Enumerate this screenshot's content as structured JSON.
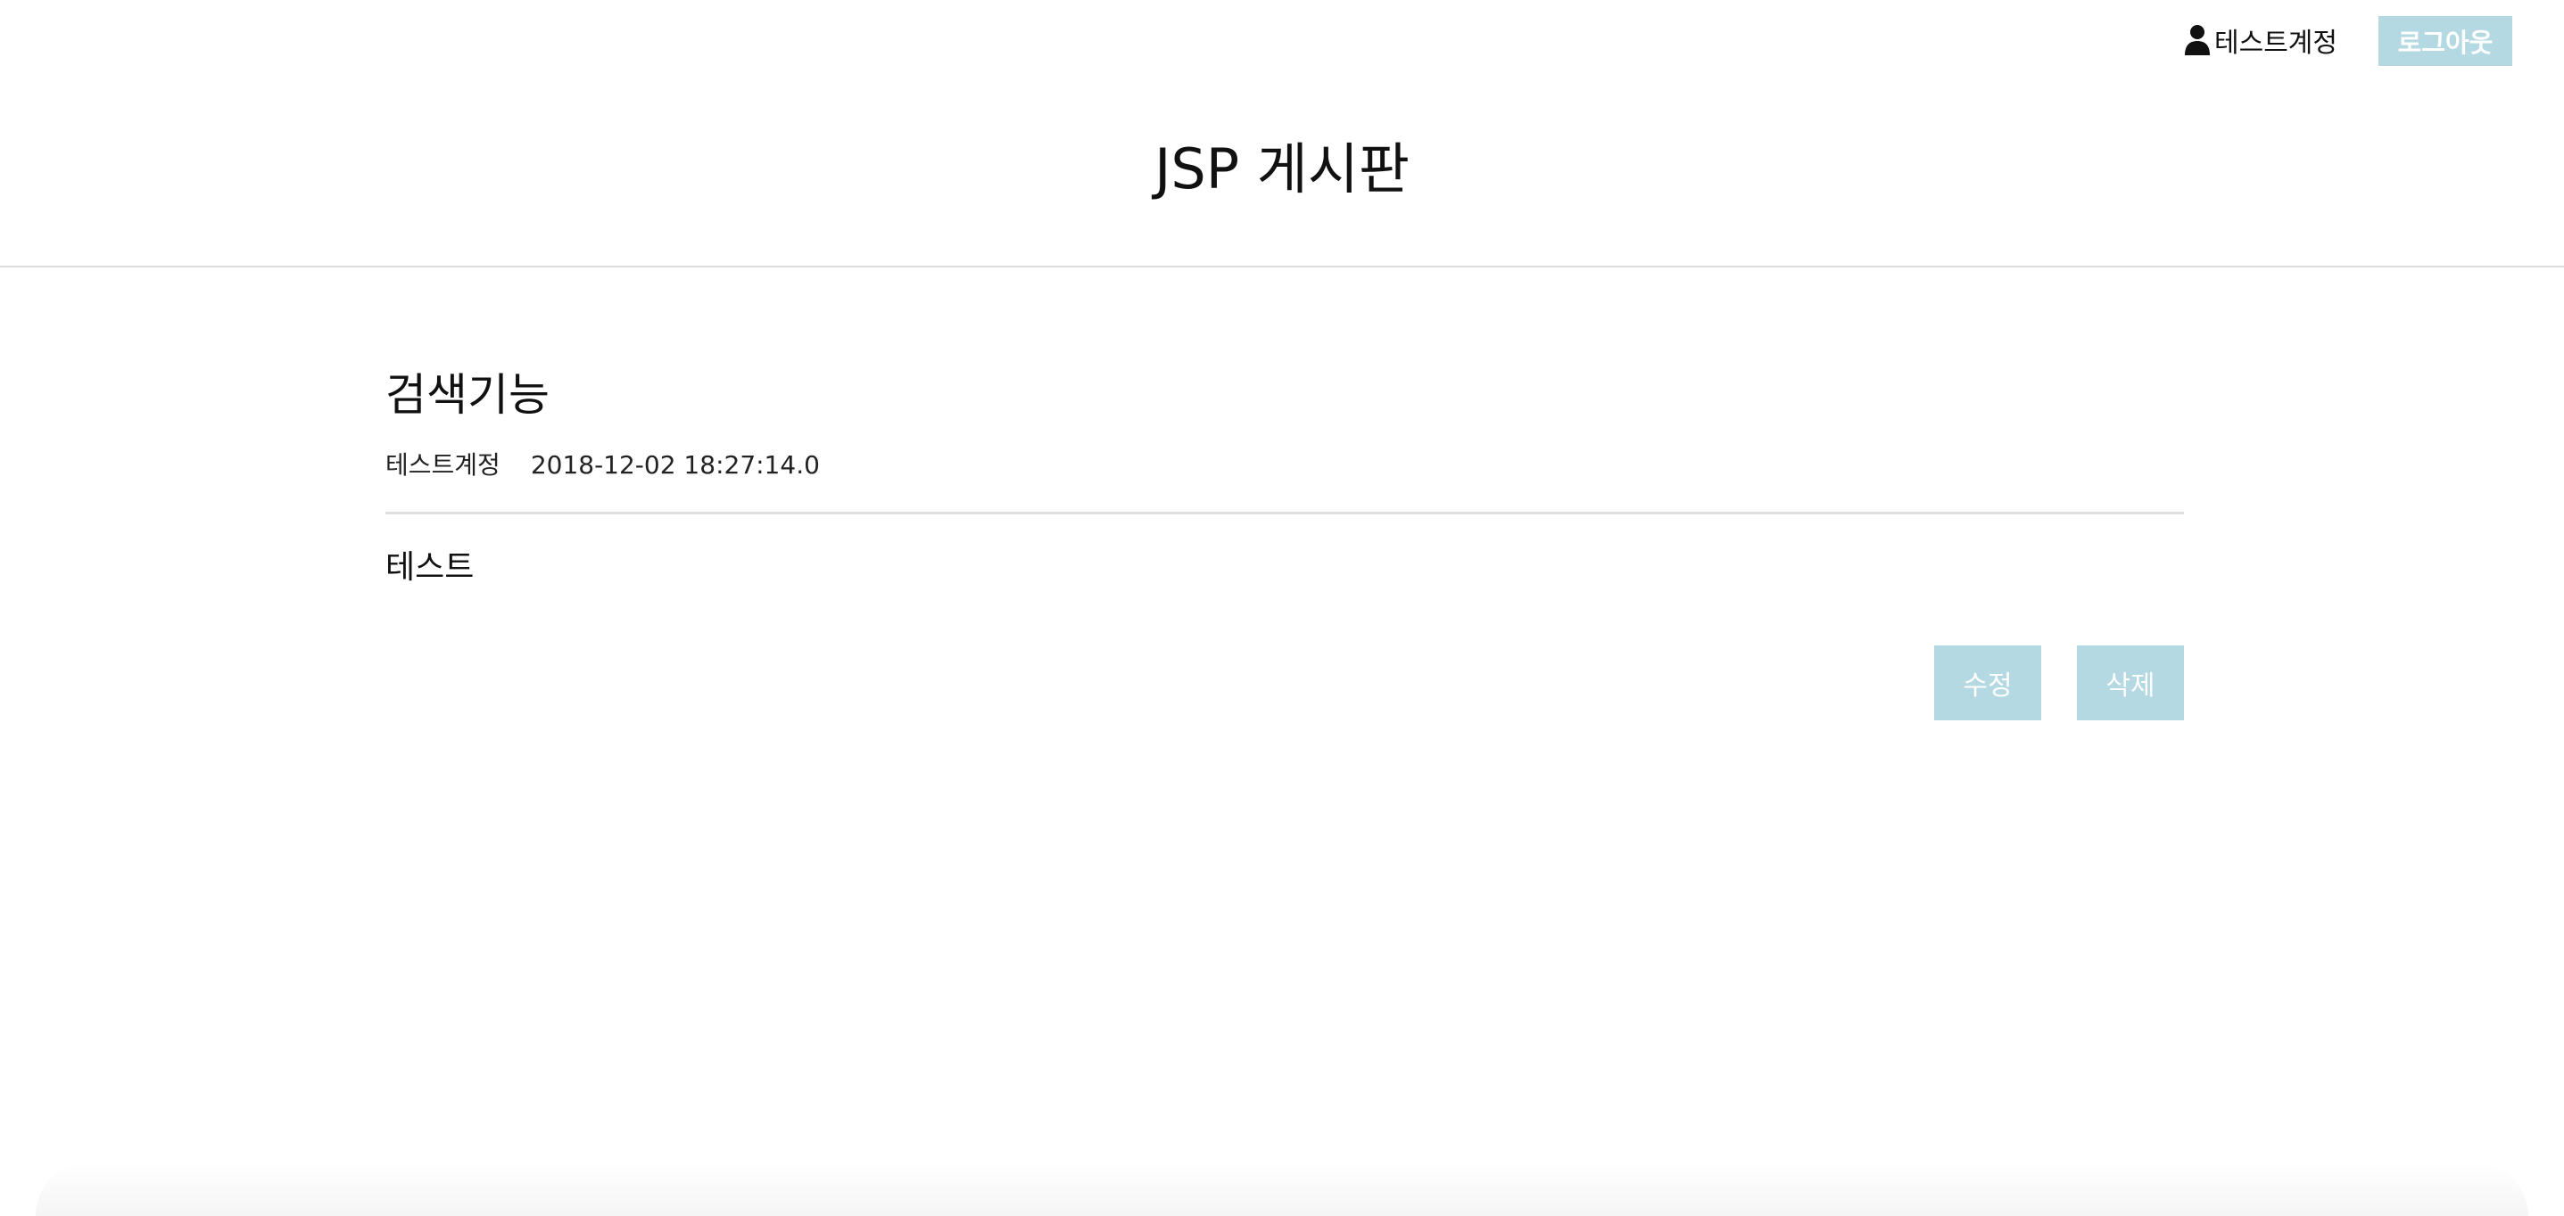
{
  "header": {
    "user_name": "테스트계정",
    "logout_label": "로그아웃",
    "site_title": "JSP 게시판"
  },
  "post": {
    "title": "검색기능",
    "author": "테스트계정",
    "date": "2018-12-02 18:27:14.0",
    "body": "테스트"
  },
  "actions": {
    "edit_label": "수정",
    "delete_label": "삭제"
  },
  "colors": {
    "button_bg": "#b4d9e2",
    "button_text": "#ffffff"
  }
}
